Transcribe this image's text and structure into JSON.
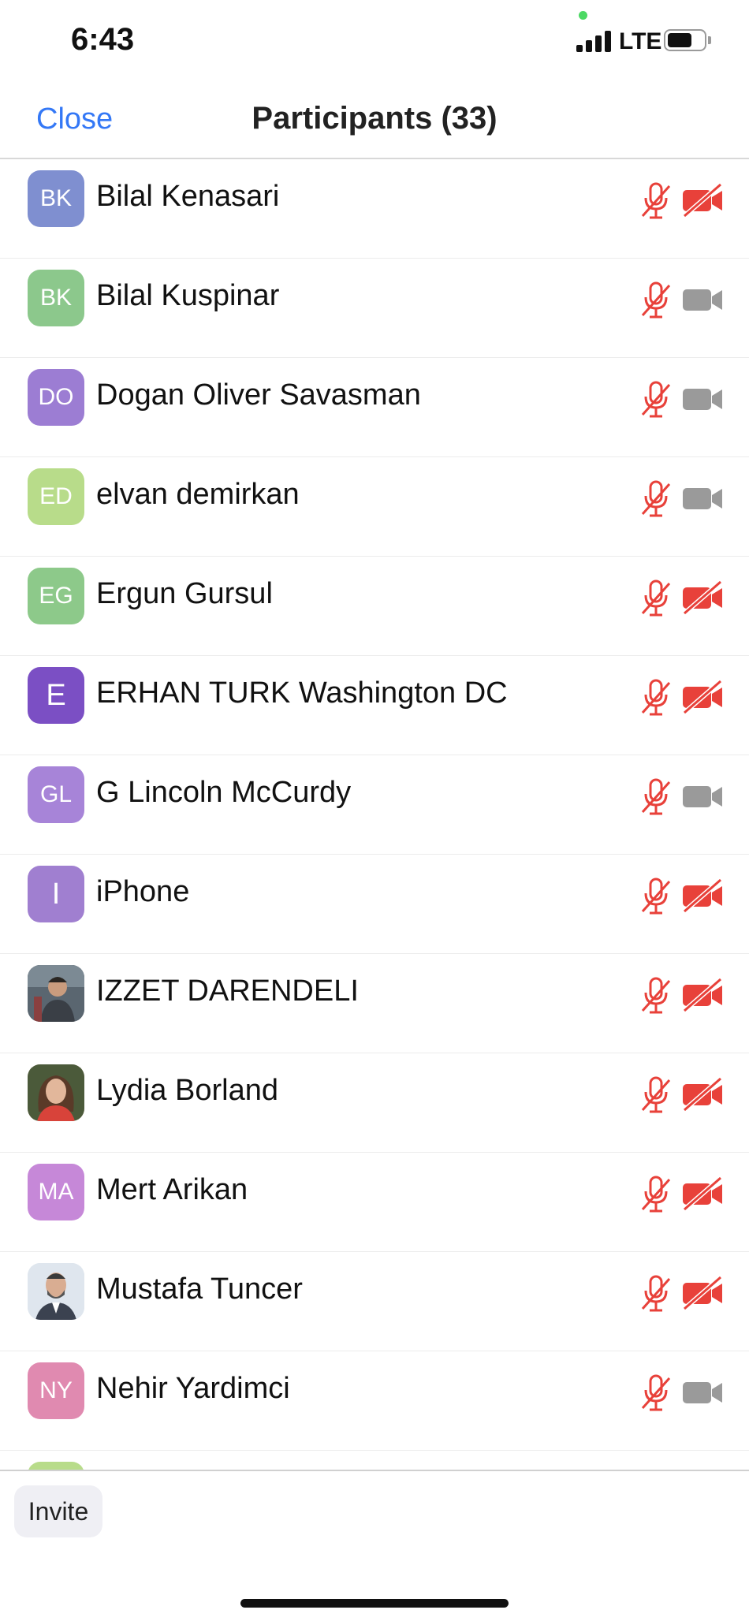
{
  "status_bar": {
    "time": "6:43",
    "network": "LTE"
  },
  "header": {
    "close_label": "Close",
    "title": "Participants (33)"
  },
  "participants": [
    {
      "name": "Bilal Kenasari",
      "initials": "BK",
      "avatar_color": "#7f8fd0",
      "avatar_type": "initials",
      "mic_muted": true,
      "video_off": true
    },
    {
      "name": "Bilal Kuspinar",
      "initials": "BK",
      "avatar_color": "#8cc88c",
      "avatar_type": "initials",
      "mic_muted": true,
      "video_off": false
    },
    {
      "name": "Dogan Oliver Savasman",
      "initials": "DO",
      "avatar_color": "#9c7dd3",
      "avatar_type": "initials",
      "mic_muted": true,
      "video_off": false
    },
    {
      "name": "elvan demirkan",
      "initials": "ED",
      "avatar_color": "#b8dc8a",
      "avatar_type": "initials",
      "mic_muted": true,
      "video_off": false
    },
    {
      "name": "Ergun Gursul",
      "initials": "EG",
      "avatar_color": "#8dc98a",
      "avatar_type": "initials",
      "mic_muted": true,
      "video_off": true
    },
    {
      "name": "ERHAN TURK Washington DC",
      "initials": "E",
      "avatar_color": "#7b4fc4",
      "avatar_type": "initials",
      "mic_muted": true,
      "video_off": true
    },
    {
      "name": "G Lincoln McCurdy",
      "initials": "GL",
      "avatar_color": "#a784d8",
      "avatar_type": "initials",
      "mic_muted": true,
      "video_off": false
    },
    {
      "name": "iPhone",
      "initials": "I",
      "avatar_color": "#a07fd0",
      "avatar_type": "initials",
      "mic_muted": true,
      "video_off": true
    },
    {
      "name": "IZZET DARENDELI",
      "initials": "",
      "avatar_color": "#5a6670",
      "avatar_type": "photo",
      "mic_muted": true,
      "video_off": true
    },
    {
      "name": "Lydia Borland",
      "initials": "",
      "avatar_color": "#c9a98b",
      "avatar_type": "photo",
      "mic_muted": true,
      "video_off": true
    },
    {
      "name": "Mert Arikan",
      "initials": "MA",
      "avatar_color": "#c688d8",
      "avatar_type": "initials",
      "mic_muted": true,
      "video_off": true
    },
    {
      "name": "Mustafa Tuncer",
      "initials": "",
      "avatar_color": "#dfe6ee",
      "avatar_type": "photo",
      "mic_muted": true,
      "video_off": true
    },
    {
      "name": "Nehir Yardimci",
      "initials": "NY",
      "avatar_color": "#e08ab0",
      "avatar_type": "initials",
      "mic_muted": true,
      "video_off": false
    },
    {
      "name": "",
      "initials": "",
      "avatar_color": "#b8dc8a",
      "avatar_type": "initials",
      "mic_muted": true,
      "video_off": false
    }
  ],
  "footer": {
    "invite_label": "Invite"
  },
  "colors": {
    "accent": "#3478f6",
    "muted_red": "#e8413a",
    "camera_gray": "#9a9a9a"
  }
}
